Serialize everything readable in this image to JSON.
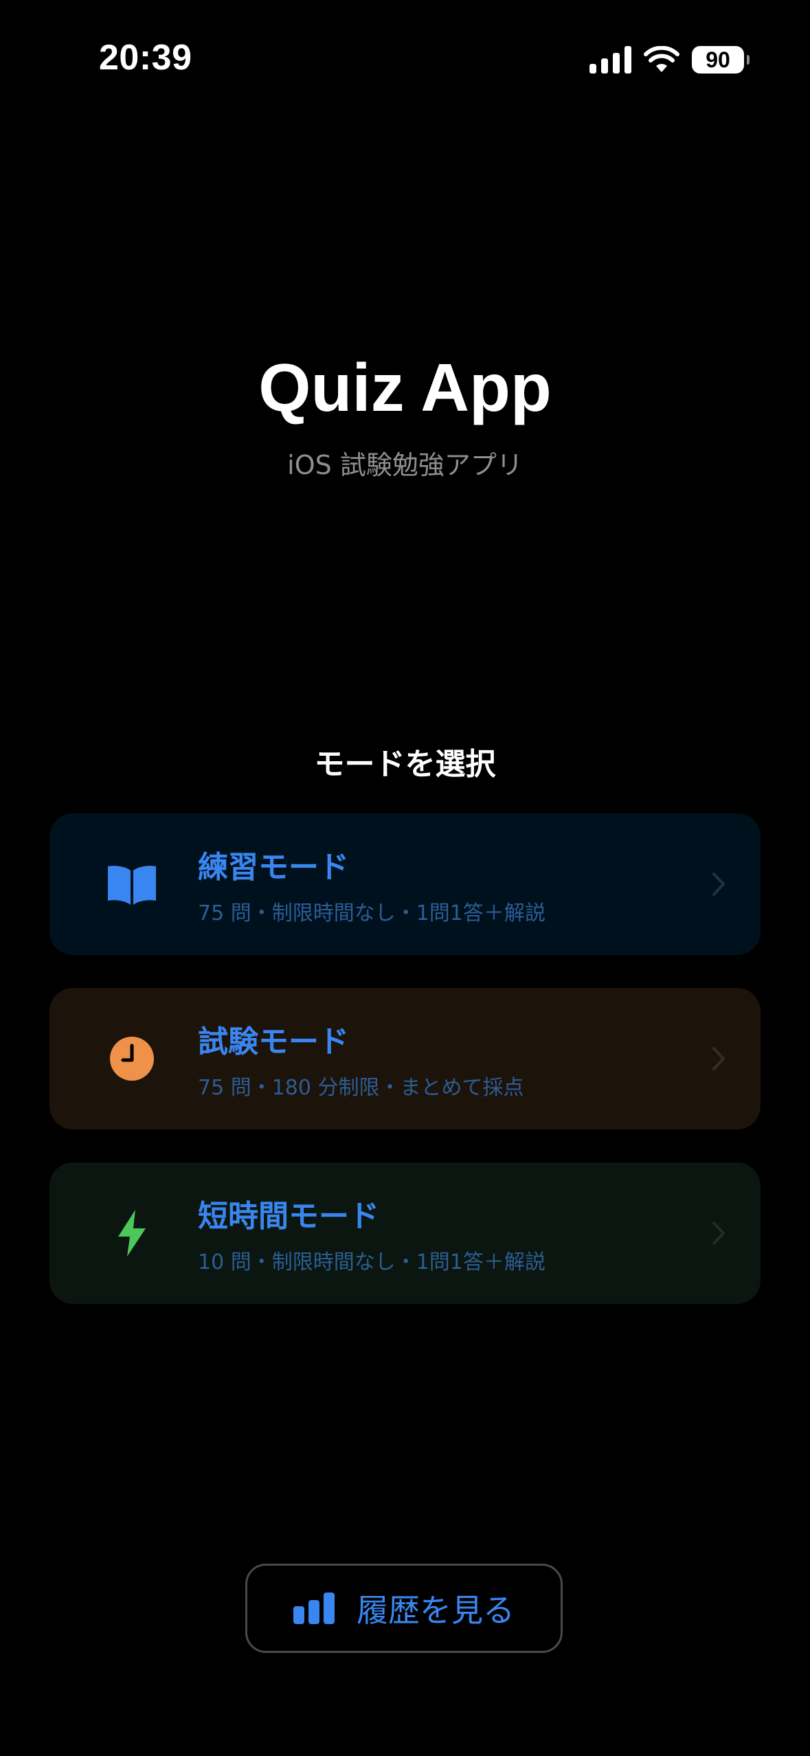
{
  "status_bar": {
    "time": "20:39",
    "battery_level": "90",
    "signal_icon": "cellular-signal-icon",
    "wifi_icon": "wifi-icon"
  },
  "header": {
    "title": "Quiz App",
    "subtitle": "iOS 試験勉強アプリ"
  },
  "mode_section": {
    "title": "モードを選択",
    "modes": [
      {
        "title": "練習モード",
        "description": "75 問・制限時間なし・1問1答＋解説",
        "icon": "open-book-icon",
        "icon_color": "#3a86f0",
        "card_color": "#00111e"
      },
      {
        "title": "試験モード",
        "description": "75 問・180 分制限・まとめて採点",
        "icon": "clock-icon",
        "icon_color": "#f0914a",
        "card_color": "#1c130b"
      },
      {
        "title": "短時間モード",
        "description": "10 問・制限時間なし・1問1答＋解説",
        "icon": "lightning-bolt-icon",
        "icon_color": "#4cc85a",
        "card_color": "#0a160f"
      }
    ]
  },
  "history_button": {
    "label": "履歴を見る",
    "icon": "bar-chart-icon"
  },
  "colors": {
    "background": "#000000",
    "accent": "#3a86f0",
    "secondary_text": "#8e8e93",
    "description_text": "#2c5d95"
  }
}
